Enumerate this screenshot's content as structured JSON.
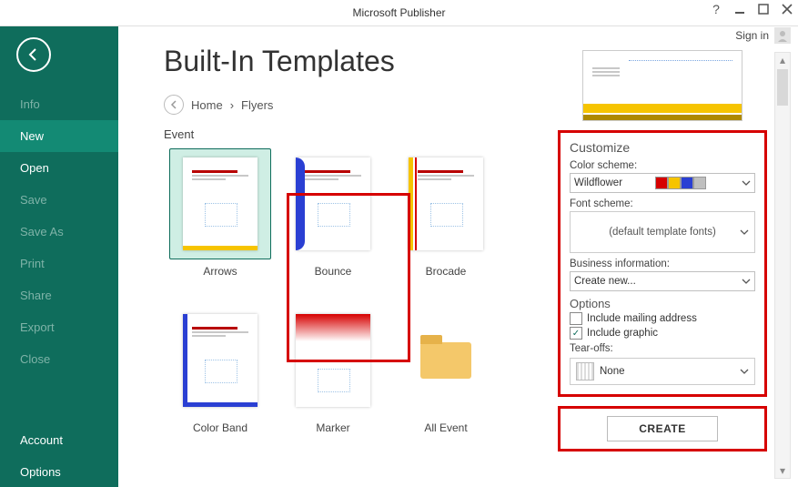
{
  "app": {
    "title": "Microsoft Publisher",
    "signin": "Sign in"
  },
  "nav": {
    "items": [
      {
        "label": "Info",
        "kind": "dim"
      },
      {
        "label": "New",
        "kind": "active"
      },
      {
        "label": "Open",
        "kind": "bright"
      },
      {
        "label": "Save",
        "kind": "dim"
      },
      {
        "label": "Save As",
        "kind": "dim"
      },
      {
        "label": "Print",
        "kind": "dim"
      },
      {
        "label": "Share",
        "kind": "dim"
      },
      {
        "label": "Export",
        "kind": "dim"
      },
      {
        "label": "Close",
        "kind": "dim"
      }
    ],
    "footer": [
      {
        "label": "Account"
      },
      {
        "label": "Options"
      }
    ]
  },
  "page": {
    "heading": "Built-In Templates",
    "breadcrumb": [
      "Home",
      "Flyers"
    ],
    "section": "Event"
  },
  "templates": [
    {
      "label": "Arrows",
      "kind": "arrows",
      "selected": true
    },
    {
      "label": "Bounce",
      "kind": "bounce"
    },
    {
      "label": "Brocade",
      "kind": "brocade"
    },
    {
      "label": "Color Band",
      "kind": "colorband"
    },
    {
      "label": "Marker",
      "kind": "marker"
    },
    {
      "label": "All Event",
      "kind": "folder"
    }
  ],
  "customize": {
    "heading": "Customize",
    "color_label": "Color scheme:",
    "color_value": "Wildflower",
    "swatches": [
      "#d60000",
      "#f6c400",
      "#2a3fd3",
      "#bfbfbf"
    ],
    "font_label": "Font scheme:",
    "font_value": "(default template fonts)",
    "bi_label": "Business information:",
    "bi_value": "Create new...",
    "options_heading": "Options",
    "opt_mail": "Include mailing address",
    "opt_mail_checked": false,
    "opt_graphic": "Include graphic",
    "opt_graphic_checked": true,
    "tearoff_label": "Tear-offs:",
    "tearoff_value": "None"
  },
  "actions": {
    "create": "CREATE"
  }
}
